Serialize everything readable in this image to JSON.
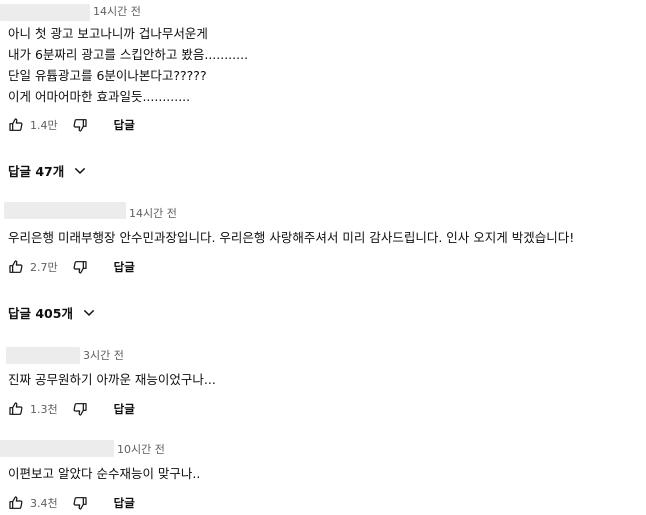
{
  "comments": [
    {
      "time": "14시간 전",
      "lines": [
        "아니 첫 광고 보고나니까 겁나무서운게",
        "내가 6분짜리 광고를 스킵안하고 봤음...........",
        "단일 유튭광고를 6분이나본다고?????",
        "이게 어마어마한 효과일듯............"
      ],
      "likes": "1.4만",
      "reply_label": "답글",
      "replies_label": "답글 47개"
    },
    {
      "time": "14시간 전",
      "lines": [
        "우리은행 미래부행장 안수민과장입니다. 우리은행 사랑해주셔서 미리 감사드립니다. 인사 오지게 박겠습니다!"
      ],
      "likes": "2.7만",
      "reply_label": "답글",
      "replies_label": "답글 405개"
    },
    {
      "time": "3시간 전",
      "lines": [
        "진짜 공무원하기 아까운 재능이었구나..."
      ],
      "likes": "1.3천",
      "reply_label": "답글"
    },
    {
      "time": "10시간 전",
      "lines": [
        "이편보고 알았다 순수재능이 맞구나.."
      ],
      "likes": "3.4천",
      "reply_label": "답글"
    }
  ],
  "icons": {
    "like": "thumbs-up-icon",
    "dislike": "thumbs-down-icon",
    "expand": "chevron-down-icon"
  },
  "colors": {
    "text": "#0f0f0f",
    "secondary": "#606060",
    "redacted": "#ececec"
  }
}
